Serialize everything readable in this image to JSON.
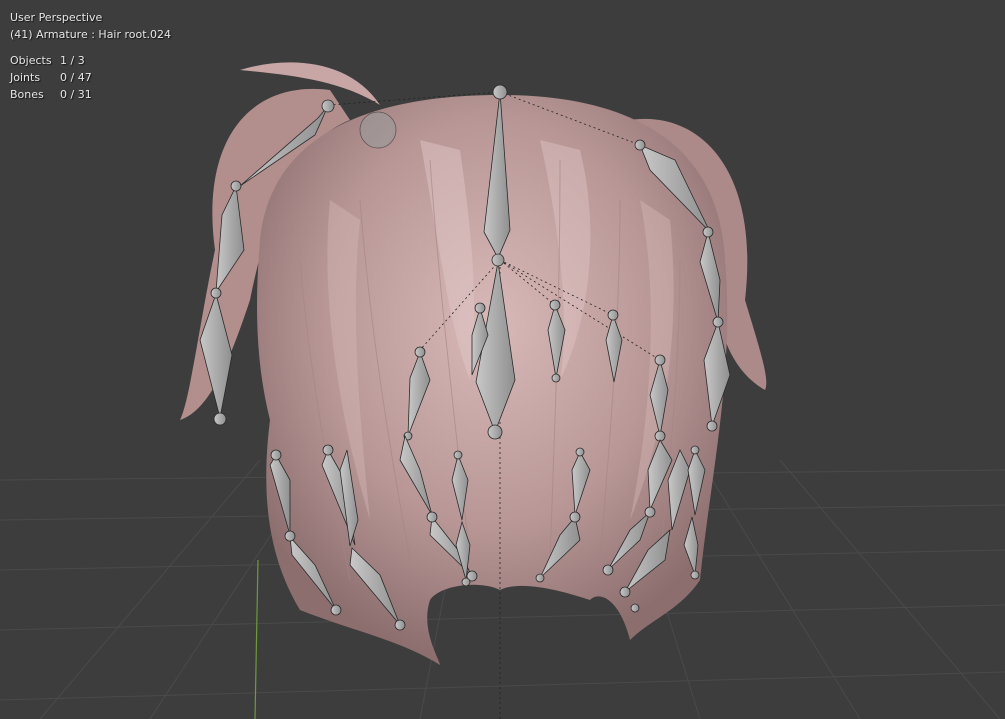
{
  "viewport": {
    "view_name": "User Perspective",
    "context_line": "(41) Armature : Hair root.024",
    "stats": [
      {
        "label": "Objects",
        "value": "1 / 3"
      },
      {
        "label": "Joints",
        "value": "0 / 47"
      },
      {
        "label": "Bones",
        "value": "0 / 31"
      }
    ]
  },
  "colors": {
    "background": "#3d3d3d",
    "grid": "#4a4a4a",
    "y_axis": "#6e9a3a",
    "hair": "#c9a9a8",
    "bone": "#b5b5b5"
  }
}
